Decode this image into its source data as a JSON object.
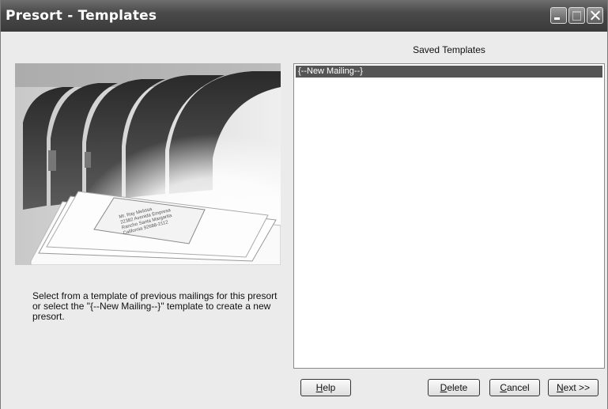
{
  "window": {
    "title": "Presort - Templates"
  },
  "photo": {
    "address_lines": [
      "Mr. Ray Melissa",
      "22382 Avenida Empresa",
      "Rancho Santa Margarita",
      "California 92688-2112"
    ]
  },
  "instructions": "Select from a template of previous mailings for this presort or select the \"{--New Mailing--}\" template to create a new presort.",
  "templates": {
    "label": "Saved Templates",
    "items": [
      "{--New Mailing--}"
    ]
  },
  "buttons": {
    "help": {
      "accel": "H",
      "rest": "elp"
    },
    "delete": {
      "accel": "D",
      "rest": "elete"
    },
    "cancel": {
      "accel": "C",
      "rest": "ancel"
    },
    "next": {
      "accel": "N",
      "rest": "ext >>"
    }
  }
}
